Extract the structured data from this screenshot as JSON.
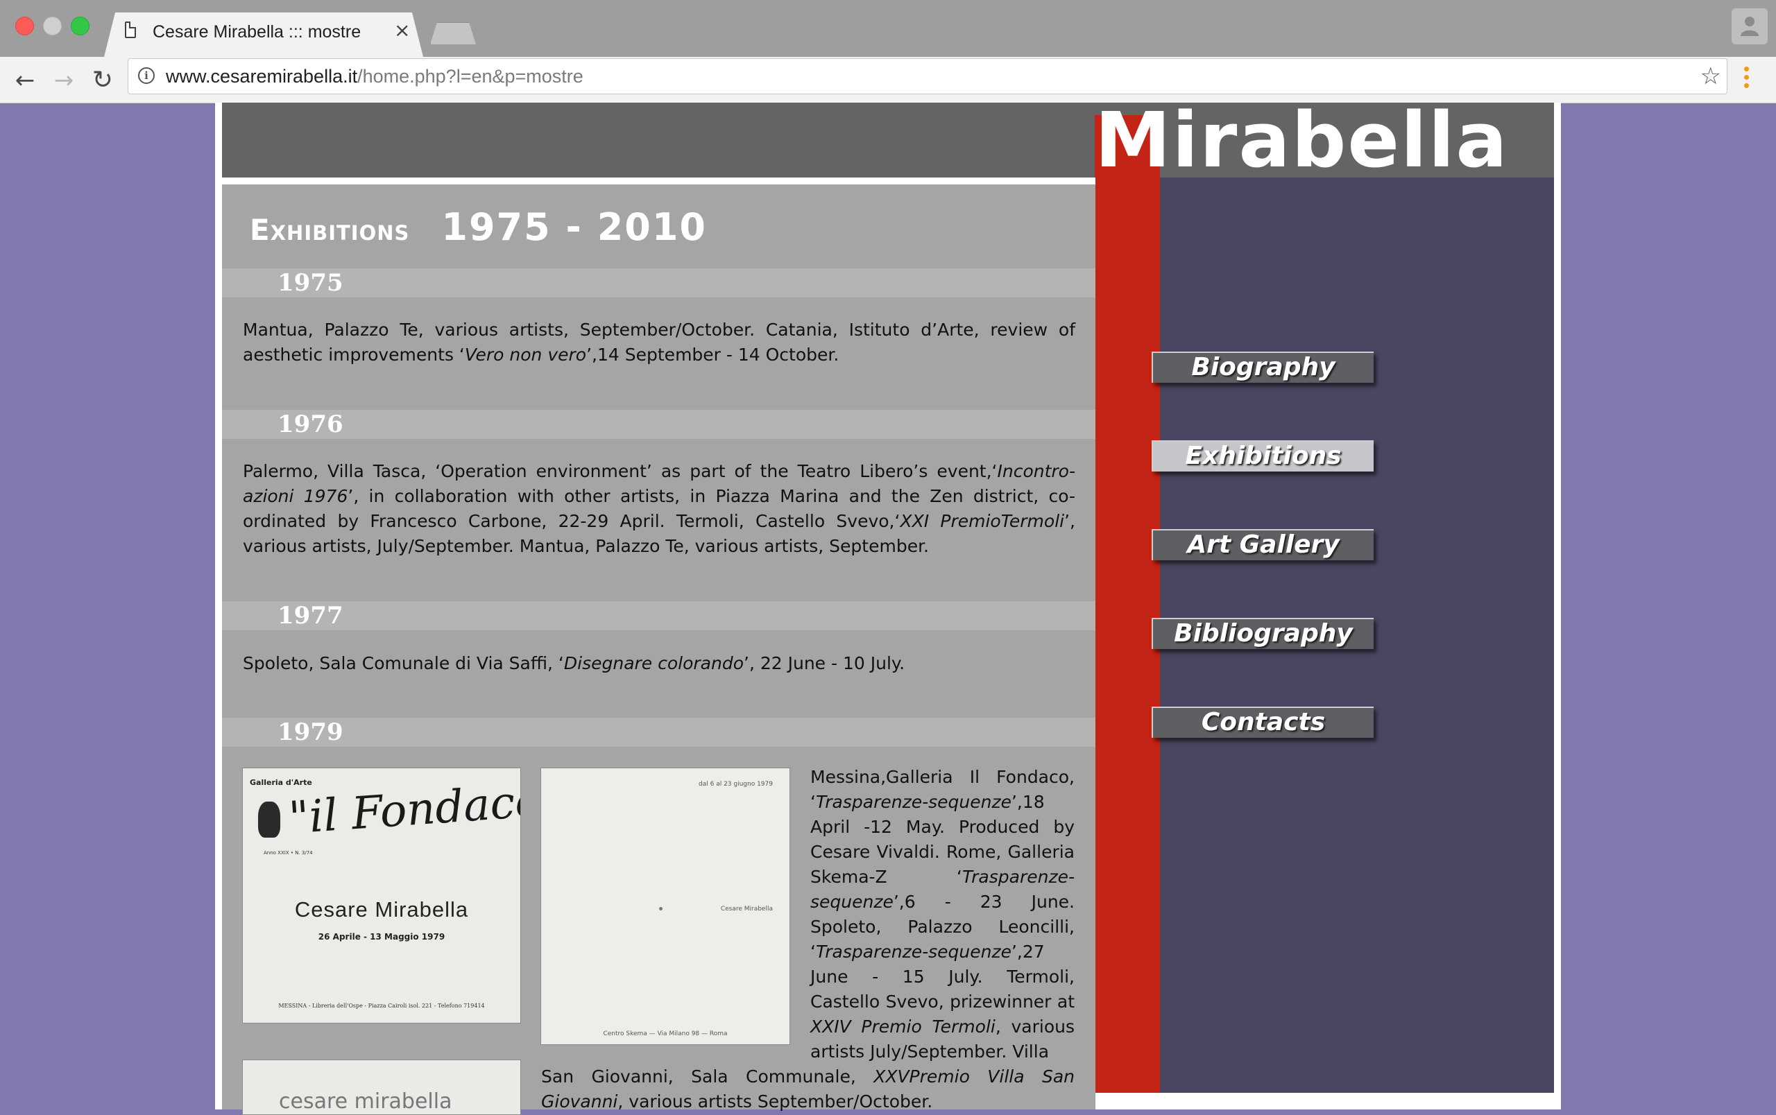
{
  "browser": {
    "tab_title": "Cesare Mirabella ::: mostre",
    "tab_close": "×",
    "url_domain": "www.cesaremirabella.it",
    "url_path": "/home.php?l=en&p=mostre",
    "back_glyph": "←",
    "forward_glyph": "→",
    "reload_glyph": "↻",
    "star_glyph": "☆",
    "info_glyph": "i"
  },
  "site": {
    "logo_text": "Mirabella",
    "title_section": "Exhibitions",
    "title_years": "1975 - 2010"
  },
  "years": [
    {
      "year": "1975",
      "text_html": "Mantua, Palazzo Te, various artists, September/October. Catania, Istituto d’Arte, review of aesthetic improvements ‘<i>Vero non vero</i>’,14 September - 14 October."
    },
    {
      "year": "1976",
      "text_html": "Palermo, Villa Tasca, ‘Operation environment’ as part of the Teatro Libero’s event,‘<i>Incontro-azioni 1976</i>’, in collaboration with other artists, in Piazza Marina and the Zen district, co-ordinated by Francesco Carbone, 22-29 April. Termoli, Castello Svevo,‘<i>XXI PremioTermoli</i>’, various artists, July/September. Mantua, Palazzo Te, various artists, September."
    },
    {
      "year": "1977",
      "text_html": "Spoleto, Sala Comunale di Via Saffi, ‘<i>Disegnare colorando</i>’, 22 June - 10 July."
    },
    {
      "year": "1979",
      "text_html": "Messina,Galleria Il Fondaco, ‘<i>Trasparenze-sequenze</i>’,18 April -12 May. Produced by Cesare Vivaldi. Rome, Galleria Skema-Z ‘<i>Trasparenze-sequenze</i>’,6 - 23 June. Spoleto, Palazzo Leoncilli, ‘<i>Trasparenze-sequenze</i>’,27 June - 15 July. Termoli, Castello Svevo, prizewinner at <i>XXIV Premio Termoli</i>, various artists July/September. Villa",
      "text_cont_html": "San Giovanni, Sala Communale, <i>XXVPremio Villa San Giovanni</i>, various artists September/October."
    }
  ],
  "catalogs": {
    "fondaco": {
      "gallery": "Galleria d'Arte",
      "script": "\"il Fondaco\"",
      "anno": "Anno XXIX • N. 3/74",
      "artist": "Cesare Mirabella",
      "dates": "26 Aprile - 13 Maggio 1979",
      "footer": "MESSINA - Libreria dell'Ospe - Piazza Cairoli isol. 221 - Telefono 719414"
    },
    "skema": {
      "top": "dal 6 al 23 giugno 1979",
      "artist": "Cesare Mirabella",
      "footer": "Centro Skema — Via Milano 98 — Roma"
    },
    "third": {
      "text": "cesare mirabella"
    }
  },
  "nav": [
    {
      "label": "Biography",
      "active": false
    },
    {
      "label": "Exhibitions",
      "active": true
    },
    {
      "label": "Art Gallery",
      "active": false
    },
    {
      "label": "Bibliography",
      "active": false
    },
    {
      "label": "Contacts",
      "active": false
    }
  ],
  "colors": {
    "page_background": "#8079b0",
    "header_band": "#646464",
    "content_background": "#a5a5a5",
    "year_band": "#b4b4b4",
    "sidebar_red": "#c42415",
    "sidebar_dark": "#4a4560",
    "nav_button": "#5f5f63",
    "nav_button_active": "#c6c6ca"
  }
}
